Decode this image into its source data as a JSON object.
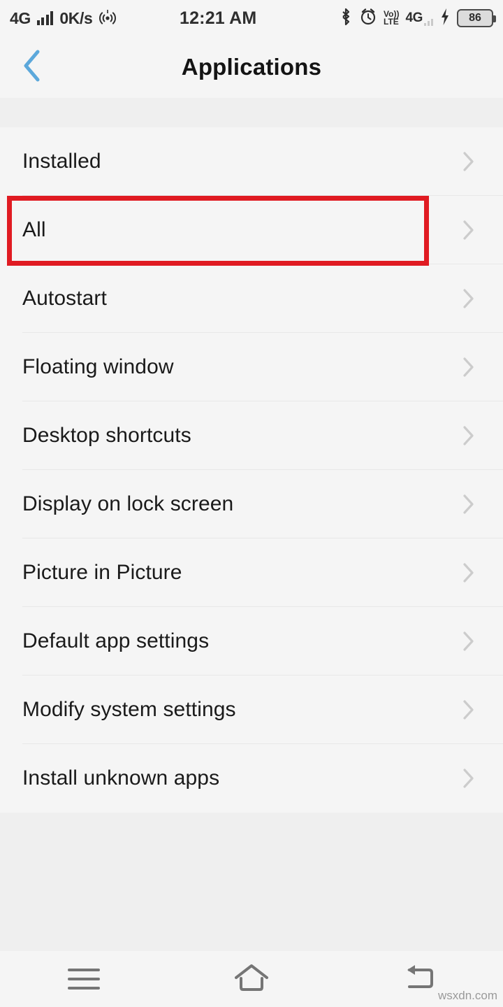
{
  "status_bar": {
    "network_label": "4G",
    "data_rate": "0K/s",
    "hotspot_icon": "hotspot-icon",
    "signal_icon": "signal-bars-icon",
    "time": "12:21 AM",
    "bluetooth_icon": "bluetooth-icon",
    "alarm_icon": "alarm-clock-icon",
    "volte_top": "Vo))",
    "volte_bottom": "LTE",
    "network_label_2": "4G",
    "charging_icon": "charging-bolt-icon",
    "battery_level": "86"
  },
  "header": {
    "back_icon": "back-chevron-icon",
    "title": "Applications"
  },
  "list": {
    "items": [
      {
        "label": "Installed",
        "chevron": "chevron-right-icon"
      },
      {
        "label": "All",
        "chevron": "chevron-right-icon"
      },
      {
        "label": "Autostart",
        "chevron": "chevron-right-icon"
      },
      {
        "label": "Floating window",
        "chevron": "chevron-right-icon"
      },
      {
        "label": "Desktop shortcuts",
        "chevron": "chevron-right-icon"
      },
      {
        "label": "Display on lock screen",
        "chevron": "chevron-right-icon"
      },
      {
        "label": "Picture in Picture",
        "chevron": "chevron-right-icon"
      },
      {
        "label": "Default app settings",
        "chevron": "chevron-right-icon"
      },
      {
        "label": "Modify system settings",
        "chevron": "chevron-right-icon"
      },
      {
        "label": "Install unknown apps",
        "chevron": "chevron-right-icon"
      }
    ]
  },
  "highlight": {
    "target_label": "All",
    "color": "#e01b22"
  },
  "nav_bar": {
    "menu_icon": "menu-hamburger-icon",
    "home_icon": "home-icon",
    "back_icon": "back-return-icon"
  },
  "watermark": {
    "text": "wsxdn.com"
  },
  "colors": {
    "accent_blue": "#5ca8db",
    "highlight_red": "#e01b22",
    "list_bg": "#f5f5f5",
    "page_bg": "#efefef",
    "divider": "#e8e8e8",
    "chevron_gray": "#cccccc"
  }
}
